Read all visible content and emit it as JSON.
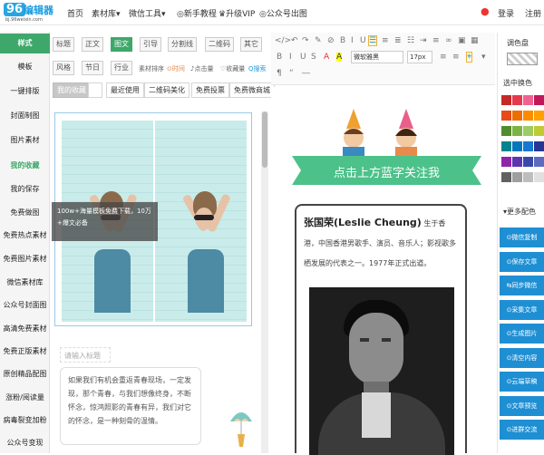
{
  "header": {
    "logo_mark": "96",
    "logo_brand": "编辑器",
    "logo_url": "bj.96weixin.com",
    "nav": [
      "首页",
      "素材库▾",
      "微信工具▾",
      "◎新手教程",
      "♛升级VIP",
      "◎公众号出图"
    ],
    "login": "登录",
    "register": "注册"
  },
  "sidebar": {
    "items": [
      "样式",
      "模板",
      "一键排版",
      "封面制图",
      "图片素材",
      "我的收藏",
      "我的保存",
      "免费做图",
      "免费热点素材",
      "免费图片素材",
      "微信素材库",
      "公众号封面图",
      "高清免费素材",
      "免费正版素材",
      "原创精品配图",
      "涨粉/阅读量",
      "病毒裂变加粉",
      "公众号变现"
    ],
    "active_index": 0,
    "highlight_index": 5
  },
  "filters": {
    "row1": [
      "标题",
      "正文",
      "图文",
      "引导",
      "分割线",
      "二维码",
      "其它"
    ],
    "row1_active": 2,
    "row2": [
      "风格",
      "节日",
      "行业"
    ],
    "row2_plain": [
      "素材排序",
      "⊙时间",
      "♪点击量",
      "♡收藏量",
      "Q搜索"
    ],
    "tabs": [
      "我的收藏",
      "",
      "最近使用",
      "二维码美化",
      "免费投票",
      "免费微商城"
    ]
  },
  "preview": {
    "tooltip_line1": "100w+海量模板免费下载，10万",
    "tooltip_line2": "+爆文必备",
    "text_placeholder": "请输入标题",
    "body_text": "如果我们有机会重返青春现场，一定发现，那个青春，与我们想像终身，不断怀念，惊鸿照影的青春有异，我们对它的怀念，是一种刻骨的温情。"
  },
  "toolbar": {
    "row1": [
      "</>",
      "↶",
      "↷",
      "✎",
      "⊘",
      "B",
      "Ⅰ",
      "U",
      "S",
      "☰",
      "≡",
      "≣",
      "☷"
    ],
    "row2": [
      "B",
      "I",
      "U",
      "S",
      "A",
      "A",
      "≡",
      "≡"
    ],
    "font_select": "微软雅黑",
    "size_select": "17px",
    "style_select": "⌖"
  },
  "editor": {
    "banner_text": "点击上方蓝字关注我",
    "article_title": "张国荣(Leslie Cheung)",
    "article_text": "生于香港，中国香港男歌手、演员、音乐人；影视歌多栖发展的代表之一。1977年正式出道。"
  },
  "color_panel": {
    "title": "调色盘",
    "swap_label": "选中换色",
    "more_label": "▾更多配色",
    "swatches": [
      "#c62828",
      "#e53950",
      "#f06292",
      "#c2185b",
      "#7b1fa2",
      "#e64a19",
      "#ef6c00",
      "#fb8c00",
      "#ffa000",
      "#f9a825",
      "#558b2f",
      "#7cb342",
      "#9ccc65",
      "#c0ca33",
      "#00897b",
      "#00838f",
      "#0277bd",
      "#1976d2",
      "#283593",
      "#6a1b9a",
      "#8e24aa",
      "#5e35b1",
      "#3949ab",
      "#5c6bc0",
      "#424242",
      "#616161",
      "#9e9e9e",
      "#bdbdbd",
      "#e0e0e0"
    ],
    "actions": [
      "⊙微信复制",
      "⊙保存文章",
      "⇆同步微信",
      "⊙采集文章",
      "⊙生成图片",
      "⊙清空内容",
      "⊙云端草稿",
      "⊙文章预览",
      "⊙进群交流"
    ]
  },
  "colors": {
    "accent_green": "#3ea86a",
    "banner_green": "#4cc28a",
    "action_blue": "#1f8fd4"
  }
}
